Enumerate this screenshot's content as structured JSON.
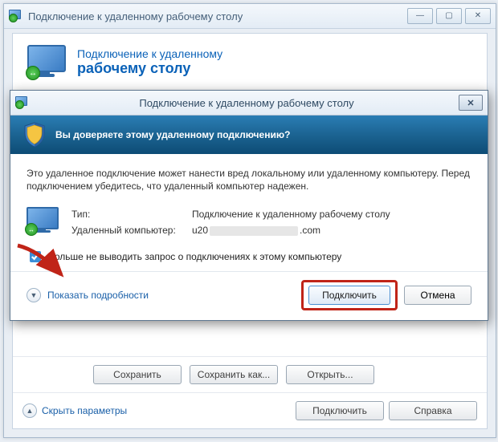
{
  "back_window": {
    "title": "Подключение к удаленному рабочему столу",
    "brand_line1": "Подключение к удаленному",
    "brand_line2": "рабочему столу",
    "buttons": {
      "save": "Сохранить",
      "save_as": "Сохранить как...",
      "open": "Открыть..."
    },
    "footer": {
      "hide_params": "Скрыть параметры",
      "connect": "Подключить",
      "help": "Справка"
    },
    "window_controls": {
      "min": "—",
      "max": "▢",
      "close": "✕"
    }
  },
  "dialog": {
    "title": "Подключение к удаленному рабочему столу",
    "banner": "Вы доверяете этому удаленному подключению?",
    "warning": "Это удаленное подключение может нанести вред локальному или удаленному компьютеру. Перед подключением убедитесь, что удаленный компьютер надежен.",
    "info": {
      "type_label": "Тип:",
      "type_value": "Подключение к удаленному рабочему столу",
      "host_label": "Удаленный компьютер:",
      "host_prefix": "u20",
      "host_suffix": ".com"
    },
    "checkbox_label": "Больше не выводить запрос о подключениях к этому компьютеру",
    "show_details": "Показать подробности",
    "connect": "Подключить",
    "cancel": "Отмена",
    "close_glyph": "✕"
  },
  "icons": {
    "badge_glyph": "↔",
    "chev_up": "▲",
    "chev_down": "▼"
  }
}
